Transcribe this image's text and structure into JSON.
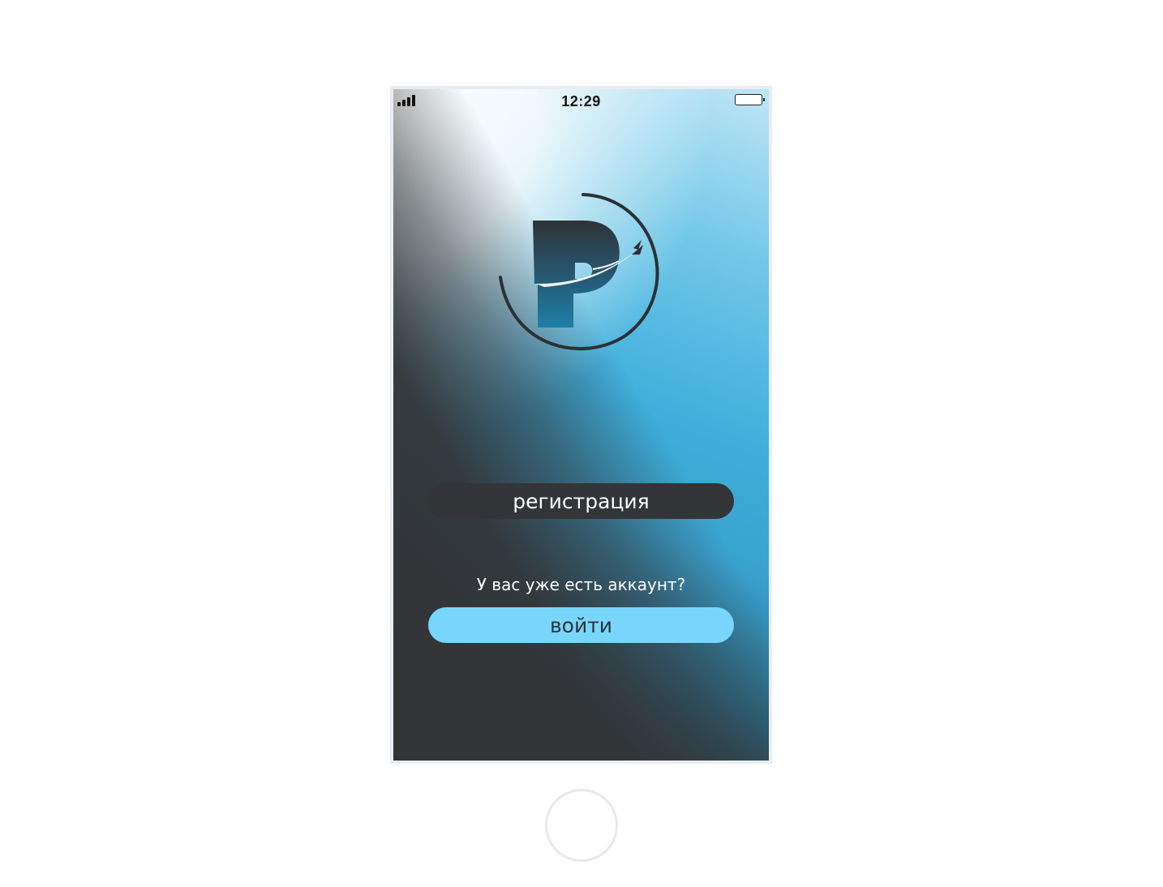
{
  "status_bar": {
    "time": "12:29",
    "signal_icon": "signal-bars-icon",
    "battery_icon": "battery-icon"
  },
  "logo": {
    "icon": "logo-p-airplane-icon"
  },
  "actions": {
    "register_label": "регистрация",
    "question": "У вас уже есть аккаунт?",
    "login_label": "войти"
  },
  "colors": {
    "register_button": "#333538",
    "login_button": "#78d6fd",
    "accent_blue": "#3eaedc"
  }
}
